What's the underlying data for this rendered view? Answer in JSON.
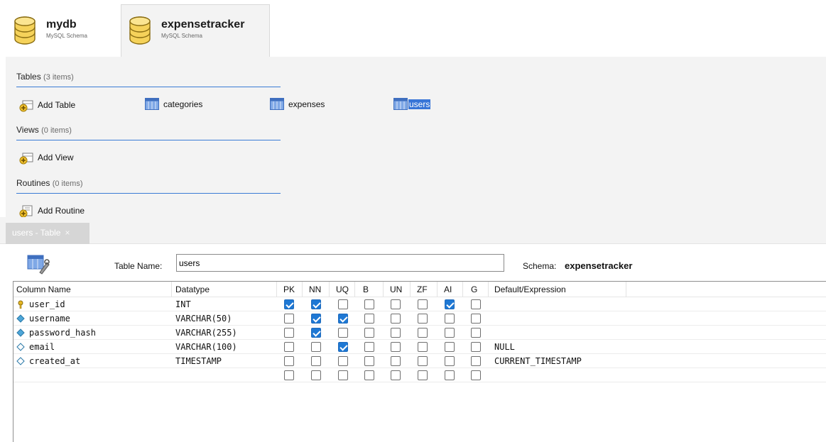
{
  "schemas": [
    {
      "name": "mydb",
      "type": "MySQL Schema"
    },
    {
      "name": "expensetracker",
      "type": "MySQL Schema"
    }
  ],
  "overview": {
    "tables": {
      "title": "Tables",
      "count": "(3 items)",
      "add_label": "Add Table",
      "items": [
        "categories",
        "expenses",
        "users"
      ],
      "selected": "users"
    },
    "views": {
      "title": "Views",
      "count": "(0 items)",
      "add_label": "Add View"
    },
    "routines": {
      "title": "Routines",
      "count": "(0 items)",
      "add_label": "Add Routine"
    }
  },
  "editor_tab": {
    "label": "users - Table",
    "close": "×"
  },
  "editor": {
    "table_name_label": "Table Name:",
    "table_name_value": "users",
    "schema_label": "Schema:",
    "schema_value": "expensetracker",
    "columns_header": [
      "Column Name",
      "Datatype",
      "PK",
      "NN",
      "UQ",
      "B",
      "UN",
      "ZF",
      "AI",
      "G",
      "Default/Expression"
    ],
    "rows": [
      {
        "name": "user_id",
        "icon": "primary-key-icon",
        "datatype": "INT",
        "flags": [
          true,
          true,
          false,
          false,
          false,
          false,
          true,
          false
        ],
        "default": ""
      },
      {
        "name": "username",
        "icon": "not-null-column-icon",
        "datatype": "VARCHAR(50)",
        "flags": [
          false,
          true,
          true,
          false,
          false,
          false,
          false,
          false
        ],
        "default": ""
      },
      {
        "name": "password_hash",
        "icon": "not-null-column-icon",
        "datatype": "VARCHAR(255)",
        "flags": [
          false,
          true,
          false,
          false,
          false,
          false,
          false,
          false
        ],
        "default": ""
      },
      {
        "name": "email",
        "icon": "nullable-column-icon",
        "datatype": "VARCHAR(100)",
        "flags": [
          false,
          false,
          true,
          false,
          false,
          false,
          false,
          false
        ],
        "default": "NULL"
      },
      {
        "name": "created_at",
        "icon": "nullable-column-icon",
        "datatype": "TIMESTAMP",
        "flags": [
          false,
          false,
          false,
          false,
          false,
          false,
          false,
          false
        ],
        "default": "CURRENT_TIMESTAMP"
      },
      {
        "name": "",
        "icon": "",
        "datatype": "",
        "flags": [
          false,
          false,
          false,
          false,
          false,
          false,
          false,
          false
        ],
        "default": ""
      }
    ]
  },
  "colors": {
    "selection": "#3875d7",
    "section_line": "#3a7bd5",
    "checkbox_on": "#1e78d4",
    "panel_bg": "#f3f3f3"
  }
}
